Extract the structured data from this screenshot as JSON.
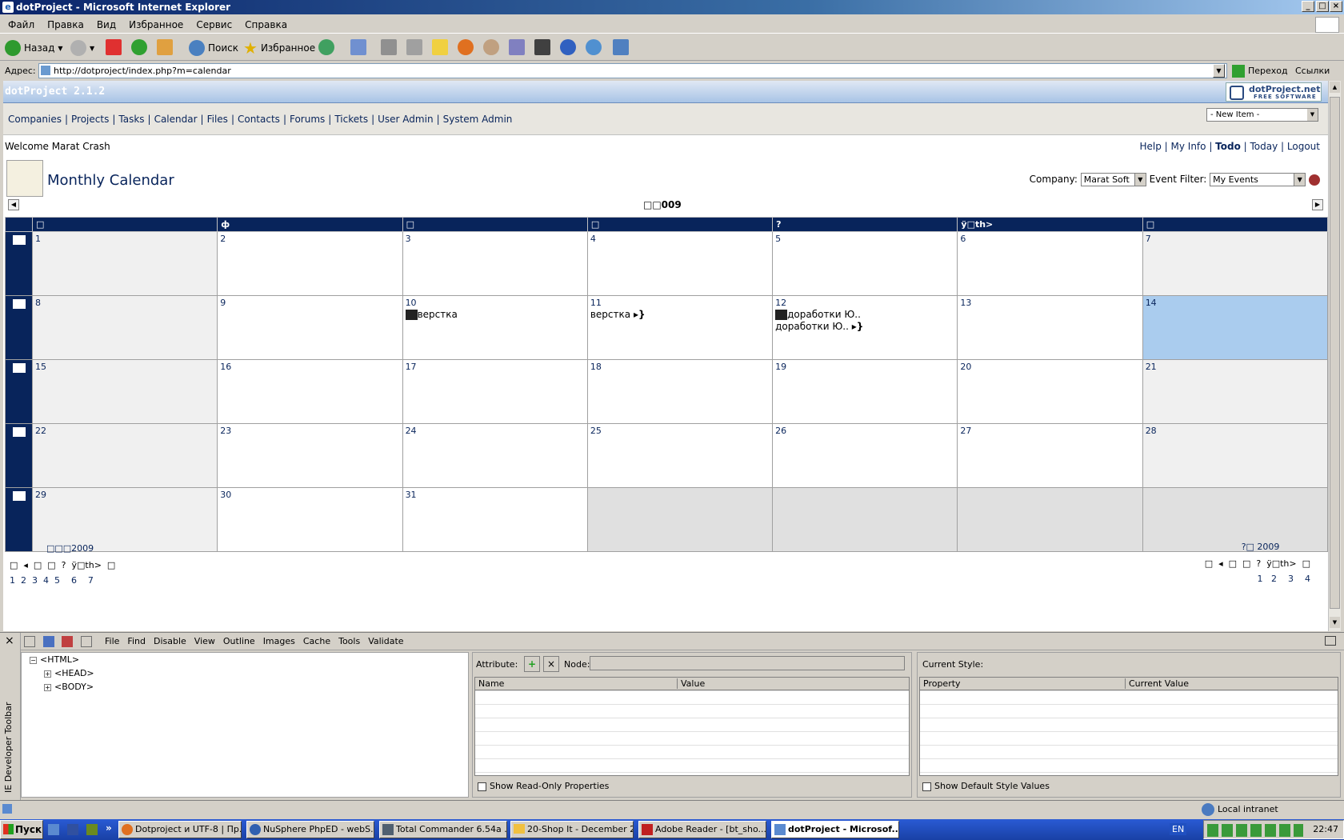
{
  "window": {
    "title": "dotProject - Microsoft Internet Explorer"
  },
  "menu": [
    "Файл",
    "Правка",
    "Вид",
    "Избранное",
    "Сервис",
    "Справка"
  ],
  "toolbar": {
    "back": "Назад",
    "search": "Поиск",
    "favorites": "Избранное"
  },
  "address": {
    "label": "Адрес:",
    "url": "http://dotproject/index.php?m=calendar",
    "go": "Переход",
    "links": "Ссылки"
  },
  "app": {
    "version": "dotProject 2.1.2",
    "logo_line1": "dotProject.net",
    "logo_line2": "FREE SOFTWARE",
    "new_item": "- New Item -"
  },
  "nav": [
    "Companies",
    "Projects",
    "Tasks",
    "Calendar",
    "Files",
    "Contacts",
    "Forums",
    "Tickets",
    "User Admin",
    "System Admin"
  ],
  "welcome": "Welcome Marat Crash",
  "user_links": [
    "Help",
    "My Info",
    "Todo",
    "Today",
    "Logout"
  ],
  "page_title": "Monthly Calendar",
  "filters": {
    "company_label": "Company:",
    "company_value": "Marat Soft",
    "event_label": "Event Filter:",
    "event_value": "My Events"
  },
  "calendar": {
    "month_title": "□□009",
    "day_headers": [
      "□",
      "ф",
      "□",
      "□",
      "?",
      "ÿ□th>",
      "□"
    ],
    "events": {
      "e10": "верстка",
      "e11": "верстка",
      "e12a": "доработки Ю..",
      "e12b": "доработки Ю.."
    }
  },
  "mini": {
    "left_title": "□□□2009",
    "right_title": "?□ 2009",
    "left_row": "1  2  3  4  5    6    7",
    "right_row": "1   2    3    4"
  },
  "devtools": {
    "menu": [
      "File",
      "Find",
      "Disable",
      "View",
      "Outline",
      "Images",
      "Cache",
      "Tools",
      "Validate"
    ],
    "tree": [
      "<HTML>",
      "<HEAD>",
      "<BODY>"
    ],
    "attribute": "Attribute:",
    "node": "Node:",
    "name_col": "Name",
    "value_col": "Value",
    "current_style": "Current Style:",
    "property_col": "Property",
    "current_value_col": "Current Value",
    "show_readonly": "Show Read-Only Properties",
    "show_default": "Show Default Style Values",
    "side_label": "IE Developer Toolbar"
  },
  "status": {
    "zone": "Local intranet"
  },
  "taskbar": {
    "start": "Пуск",
    "tasks": [
      "Dotproject и UTF-8 | Пр...",
      "NuSphere PhpED - webS...",
      "Total Commander 6.54a ...",
      "20-Shop It - December 2...",
      "Adobe Reader - [bt_sho...",
      "dotProject - Microsof..."
    ],
    "lang": "EN",
    "clock": "22:47"
  }
}
